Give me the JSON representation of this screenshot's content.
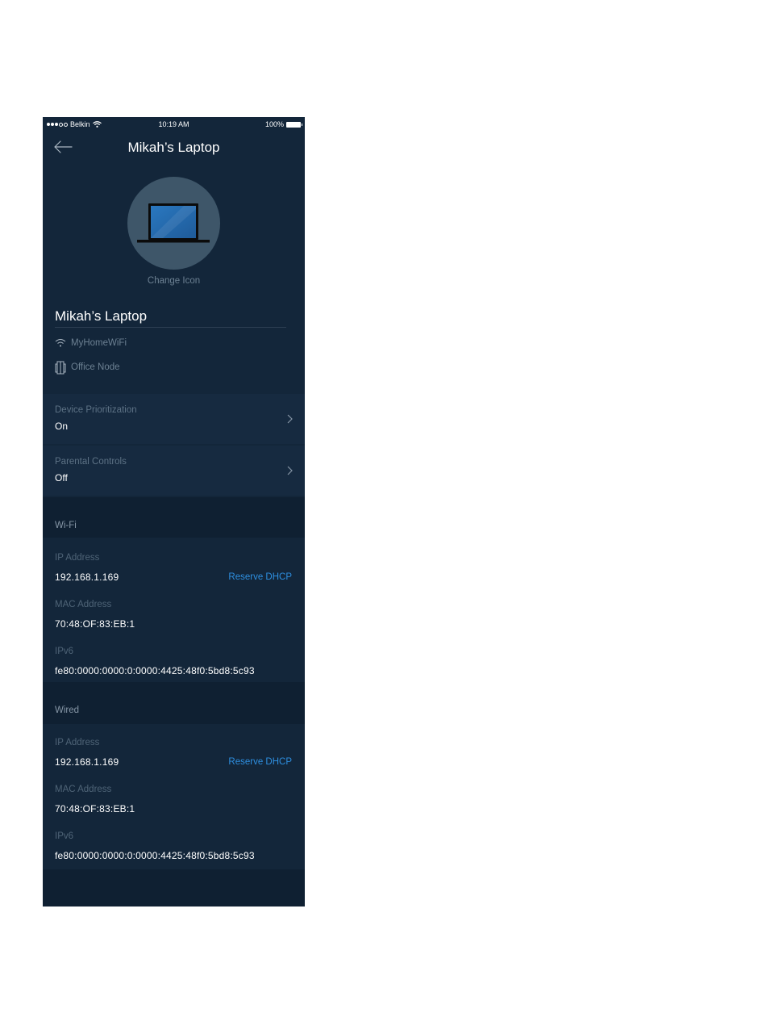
{
  "status_bar": {
    "carrier": "Belkin",
    "time": "10:19 AM",
    "battery": "100%"
  },
  "nav": {
    "title": "Mikah’s Laptop"
  },
  "avatar": {
    "change_label": "Change Icon"
  },
  "device": {
    "name": "Mikah’s Laptop",
    "network": "MyHomeWiFi",
    "node": "Office Node"
  },
  "settings": [
    {
      "label": "Device Prioritization",
      "value": "On"
    },
    {
      "label": "Parental Controls",
      "value": "Off"
    }
  ],
  "wifi": {
    "title": "Wi-Fi",
    "ip_label": "IP Address",
    "ip_value": "192.168.1.169",
    "reserve_label": "Reserve DHCP",
    "mac_label": "MAC Address",
    "mac_value": "70:48:OF:83:EB:1",
    "ipv6_label": "IPv6",
    "ipv6_value": "fe80:0000:0000:0:0000:4425:48f0:5bd8:5c93"
  },
  "wired": {
    "title": "Wired",
    "ip_label": "IP Address",
    "ip_value": "192.168.1.169",
    "reserve_label": "Reserve DHCP",
    "mac_label": "MAC Address",
    "mac_value": "70:48:OF:83:EB:1",
    "ipv6_label": "IPv6",
    "ipv6_value": "fe80:0000:0000:0:0000:4425:48f0:5bd8:5c93"
  },
  "colors": {
    "background": "#13263a",
    "section": "#0f2032",
    "row": "#162a40",
    "accent": "#2e8fe0",
    "avatar": "#3e5669"
  },
  "icons": [
    "back-arrow-icon",
    "laptop-icon",
    "wifi-icon",
    "node-icon",
    "chevron-right-icon"
  ]
}
